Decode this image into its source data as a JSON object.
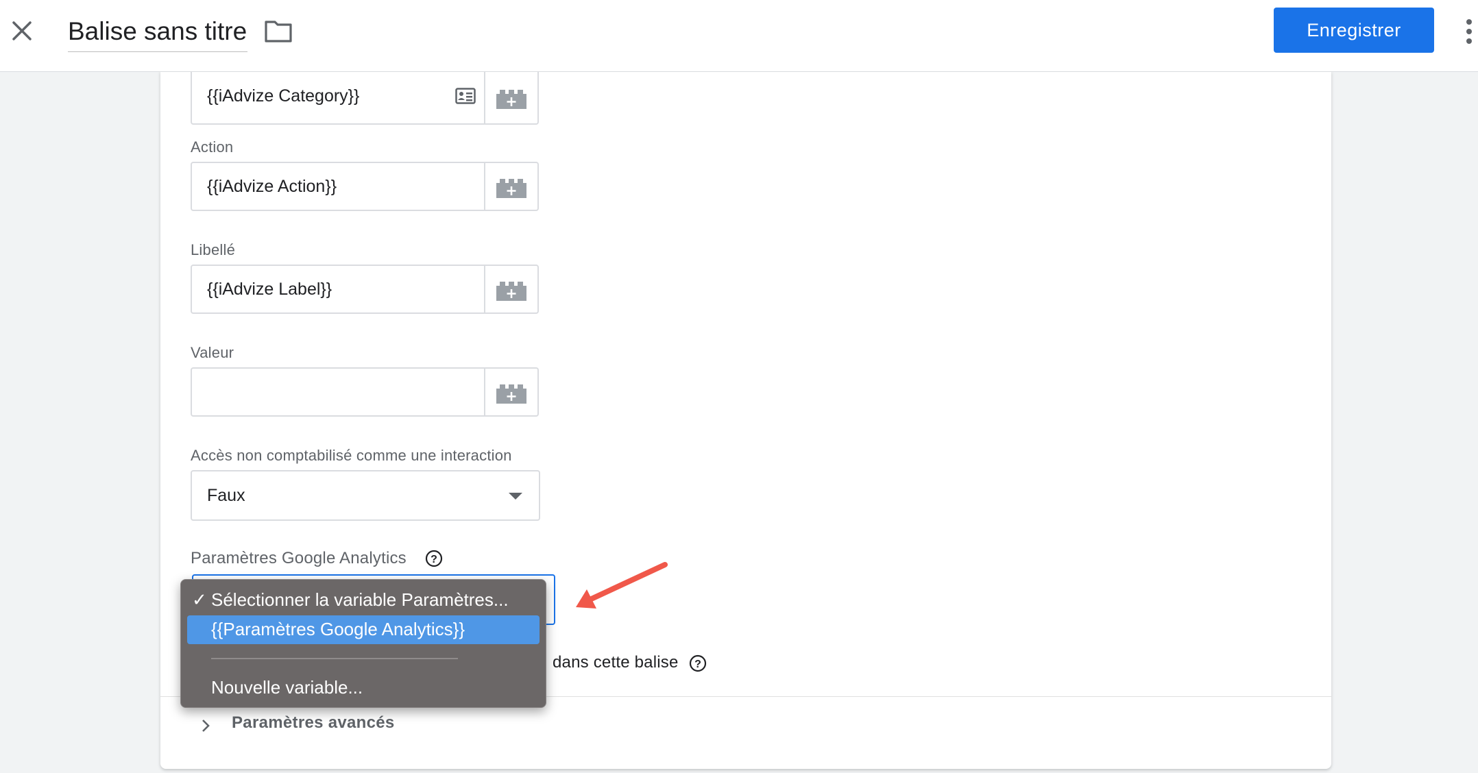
{
  "header": {
    "title": "Balise sans titre",
    "save_label": "Enregistrer"
  },
  "fields": {
    "category_value": "{{iAdvize Category}}",
    "action_label": "Action",
    "action_value": "{{iAdvize Action}}",
    "label_label": "Libellé",
    "label_value": "{{iAdvize Label}}",
    "value_label": "Valeur",
    "value_value": "",
    "non_interaction_label": "Accès non comptabilisé comme une interaction",
    "non_interaction_value": "Faux",
    "ga_settings_label": "Paramètres Google Analytics",
    "override_tail": "dans cette balise"
  },
  "dropdown": {
    "selected": "Sélectionner la variable Paramètres...",
    "highlighted": "{{Paramètres Google Analytics}}",
    "new_variable": "Nouvelle variable..."
  },
  "advanced": {
    "label": "Paramètres avancés"
  },
  "colors": {
    "accent": "#1a73e8",
    "highlight": "#4f97e6",
    "popup_bg": "#6b6767",
    "annotation_arrow": "#f0584a"
  }
}
